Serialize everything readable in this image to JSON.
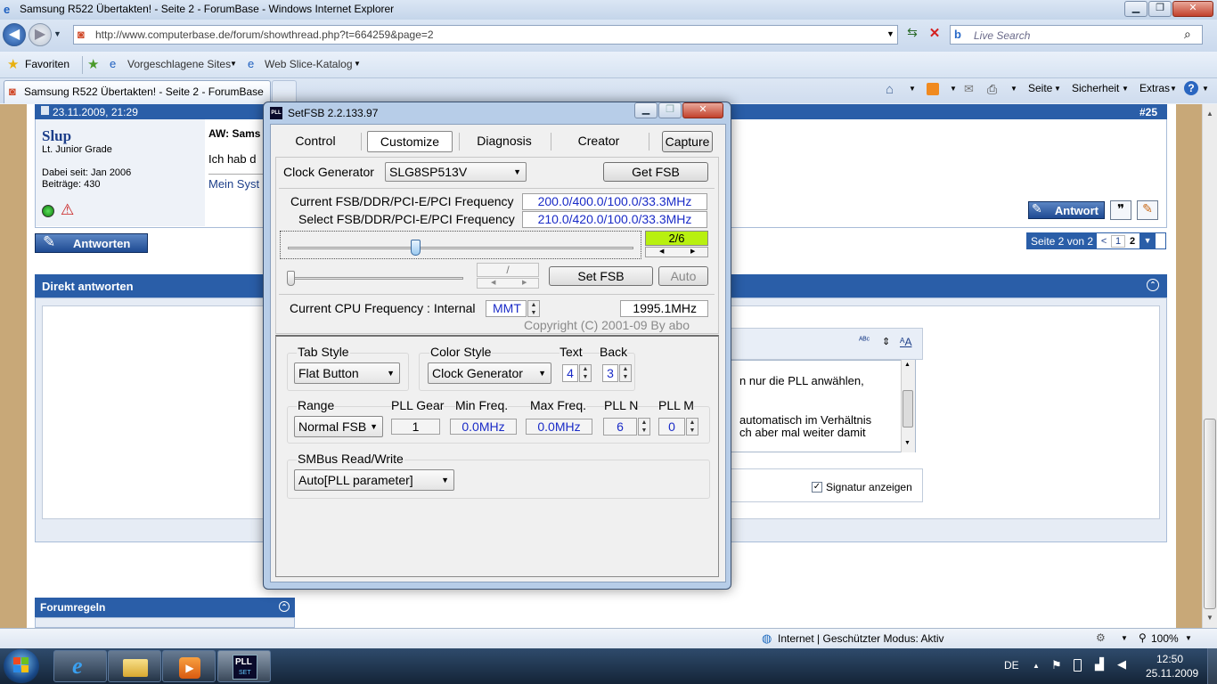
{
  "browser": {
    "title": "Samsung R522 Übertakten! - Seite 2 - ForumBase - Windows Internet Explorer",
    "url": "http://www.computerbase.de/forum/showthread.php?t=664259&page=2",
    "search_placeholder": "Live Search",
    "favorites": "Favoriten",
    "suggested_sites": "Vorgeschlagene Sites",
    "web_slice": "Web Slice-Katalog",
    "tab_title": "Samsung R522 Übertakten! - Seite 2 - ForumBase",
    "cmd_page": "Seite",
    "cmd_security": "Sicherheit",
    "cmd_extras": "Extras",
    "status_zone": "Internet | Geschützter Modus: Aktiv",
    "zoom": "100%"
  },
  "forum": {
    "post_date": "23.11.2009, 21:29",
    "post_number": "#25",
    "author": "Slup",
    "rank": "Lt. Junior Grade",
    "joined": "Dabei seit: Jan 2006",
    "posts": "Beiträge: 430",
    "post_title_partial": "AW: Sams",
    "post_text_partial": "Ich hab d",
    "signature_partial": "Mein Syst",
    "reply_button": "Antwort",
    "answer_button": "Antworten",
    "page_label": "Seite 2 von 2",
    "page_prev": "<",
    "page_1": "1",
    "page_2": "2",
    "quick_reply_title": "Direkt antworten",
    "editor_line1": "n nur die PLL anwählen,",
    "editor_line2": "automatisch im Verhältnis",
    "editor_line3": "ch aber mal weiter damit",
    "signature_checkbox": "Signatur anzeigen",
    "forum_rules": "Forumregeln"
  },
  "setfsb": {
    "title": "SetFSB 2.2.133.97",
    "tabs": [
      "Control",
      "Customize",
      "Diagnosis",
      "Creator"
    ],
    "capture": "Capture",
    "clock_gen_label": "Clock Generator",
    "clock_gen_value": "SLG8SP513V",
    "get_fsb": "Get FSB",
    "current_freq_label": "Current FSB/DDR/PCI-E/PCI Frequency",
    "current_freq_value": "200.0/400.0/100.0/33.3MHz",
    "select_freq_label": "Select FSB/DDR/PCI-E/PCI Frequency",
    "select_freq_value": "210.0/420.0/100.0/33.3MHz",
    "pll_page": "2/6",
    "slider_value": 0.37,
    "small_box": "/",
    "set_fsb": "Set FSB",
    "auto": "Auto",
    "cpu_freq_label": "Current CPU Frequency : Internal",
    "cpu_mode": "MMT",
    "cpu_freq_value": "1995.1MHz",
    "copyright": "Copyright (C) 2001-09 By abo",
    "tab_style_label": "Tab Style",
    "tab_style_value": "Flat Button",
    "color_style_label": "Color Style",
    "color_style_value": "Clock Generator",
    "text_label": "Text",
    "text_value": "4",
    "back_label": "Back",
    "back_value": "3",
    "range_label": "Range",
    "range_value": "Normal FSB",
    "pll_gear_label": "PLL Gear",
    "pll_gear_value": "1",
    "min_freq_label": "Min Freq.",
    "min_freq_value": "0.0MHz",
    "max_freq_label": "Max Freq.",
    "max_freq_value": "0.0MHz",
    "pll_n_label": "PLL N",
    "pll_n_value": "6",
    "pll_m_label": "PLL M",
    "pll_m_value": "0",
    "smbus_label": "SMBus Read/Write",
    "smbus_value": "Auto[PLL parameter]"
  },
  "taskbar": {
    "lang": "DE",
    "time": "12:50",
    "date": "25.11.2009",
    "pll_icon_text": "PLL",
    "pll_icon_sub": "SET"
  },
  "colors": {
    "forum_blue": "#2a5ea8",
    "pll_green": "#b8f010",
    "value_blue": "#1a2bc7"
  }
}
